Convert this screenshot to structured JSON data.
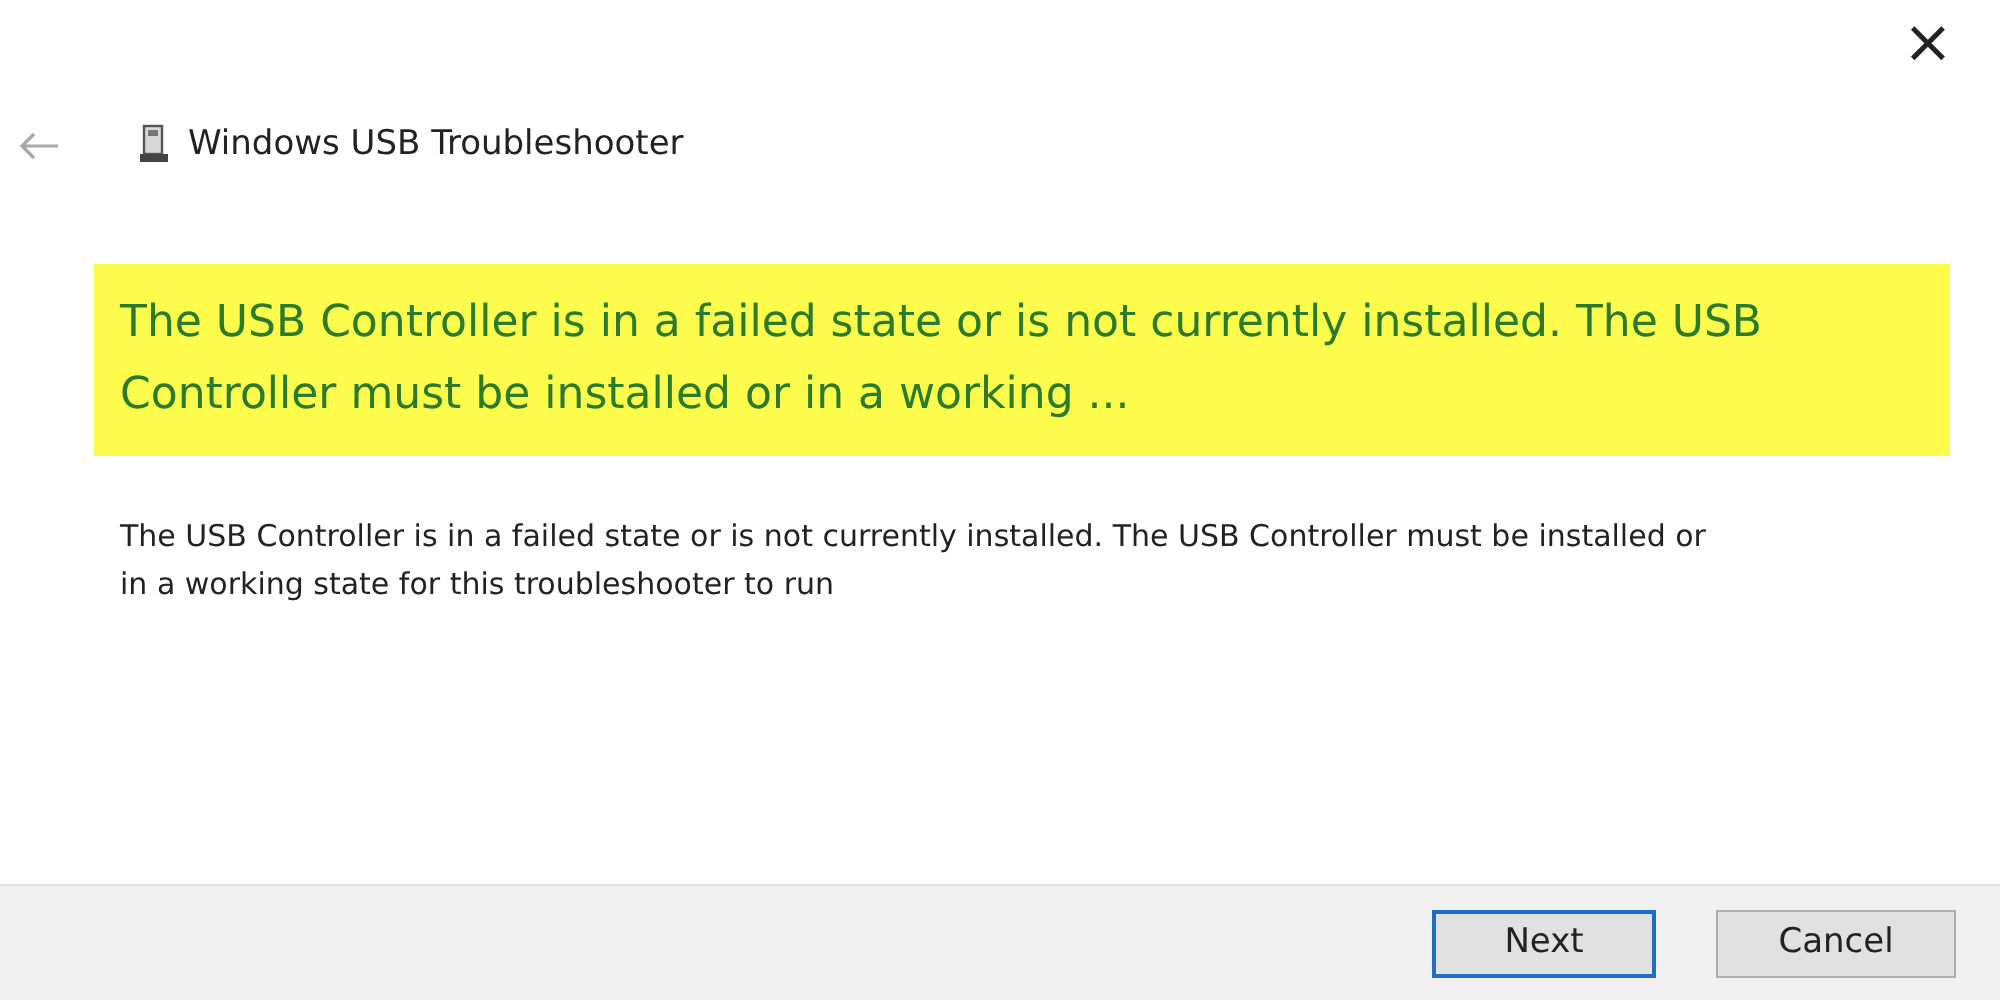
{
  "close": "×",
  "header": {
    "title": "Windows USB Troubleshooter"
  },
  "highlight": "The USB Controller is in a failed state or is not currently installed. The USB Controller must be installed or in a working ...",
  "description": "The USB Controller is in a failed state or is not currently installed. The USB Controller must be installed or in a working state for this troubleshooter to run",
  "buttons": [
    {
      "label": "Next",
      "default": true
    },
    {
      "label": "Cancel",
      "default": false
    }
  ]
}
